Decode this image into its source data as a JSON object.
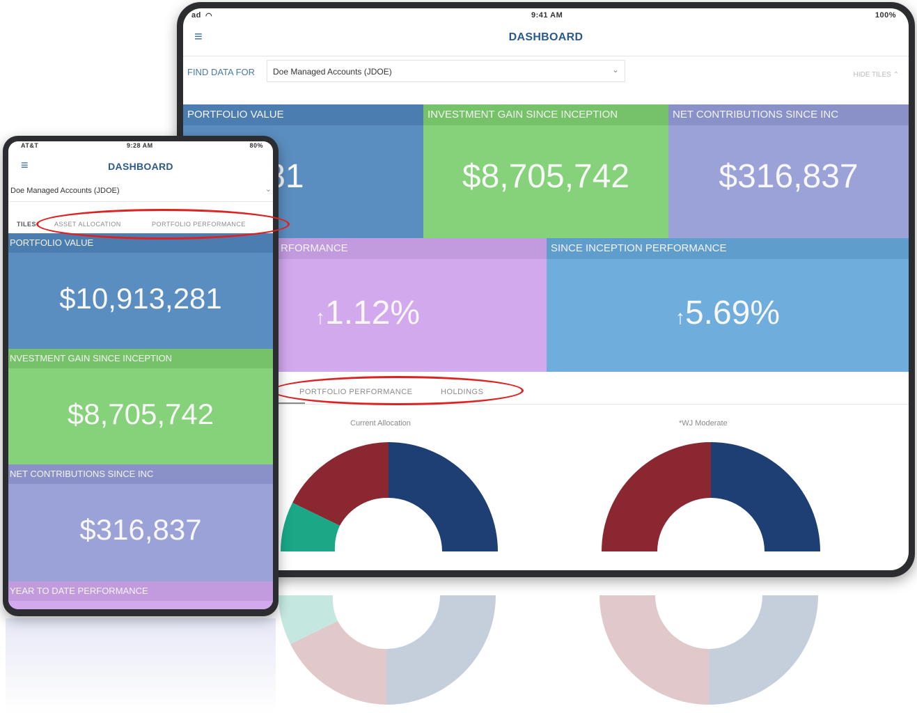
{
  "tablet": {
    "status": {
      "carrier": "ad",
      "time": "9:41 AM",
      "battery": "100%"
    },
    "title": "DASHBOARD",
    "find_label": "FIND DATA FOR",
    "account_select": "Doe Managed Accounts (JDOE)",
    "hide_tiles": "HIDE TILES",
    "tiles": [
      {
        "label": "PORTFOLIO VALUE",
        "value": "913,281"
      },
      {
        "label": "INVESTMENT GAIN SINCE INCEPTION",
        "value": "$8,705,742"
      },
      {
        "label": "NET CONTRIBUTIONS SINCE INC",
        "value": "$316,837"
      },
      {
        "label": "RFORMANCE",
        "value": "1.12%"
      },
      {
        "label": "SINCE INCEPTION PERFORMANCE",
        "value": "5.69%"
      }
    ],
    "tabs": [
      "PORTFOLIO PERFORMANCE",
      "HOLDINGS"
    ],
    "charts": [
      {
        "title": "Current Allocation"
      },
      {
        "title": "*WJ Moderate"
      }
    ]
  },
  "phone": {
    "status": {
      "carrier": "AT&T",
      "time": "9:28 AM",
      "battery": "80%"
    },
    "title": "DASHBOARD",
    "account_select": "Doe Managed Accounts (JDOE)",
    "tabs": [
      "TILES",
      "ASSET ALLOCATION",
      "PORTFOLIO PERFORMANCE"
    ],
    "tiles": [
      {
        "label": "PORTFOLIO VALUE",
        "value": "$10,913,281"
      },
      {
        "label": "NVESTMENT GAIN SINCE INCEPTION",
        "value": "$8,705,742"
      },
      {
        "label": "NET CONTRIBUTIONS SINCE INC",
        "value": "$316,837"
      },
      {
        "label": "YEAR TO DATE PERFORMANCE",
        "value": ""
      }
    ]
  },
  "colors": {
    "blue_tile": "#5b8ec0",
    "green_tile": "#86d27a",
    "purple_tile": "#9ba2d8",
    "lilac_tile": "#d3a9ee",
    "sky_tile": "#6faedc",
    "navy": "#1d3f73",
    "maroon": "#8a2731",
    "teal": "#1aa887",
    "highlight": "#dd2222"
  }
}
